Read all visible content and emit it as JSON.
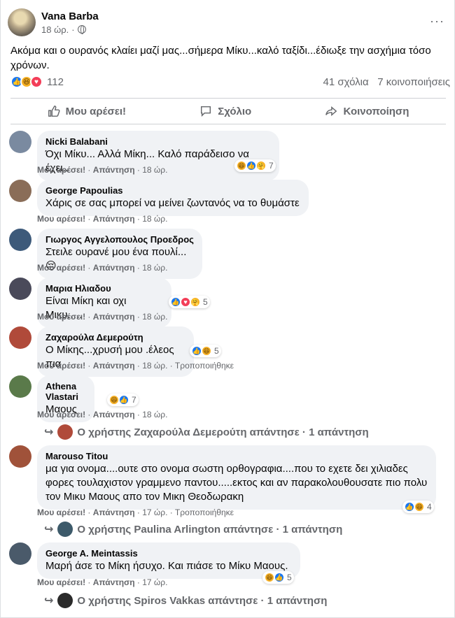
{
  "post": {
    "author": "Vana Barba",
    "time": "18 ώρ.",
    "text": "Ακόμα και ο ουρανός κλαίει μαζί μας...σήμερα Μίκυ...καλό ταξίδι...έδιωξε την ασχήμια τόσο χρόνων.",
    "reaction_count": "112",
    "comments_count": "41 σχόλια",
    "shares_count": "7 κοινοποιήσεις",
    "more": "···"
  },
  "actions": {
    "like": "Μου αρέσει!",
    "comment": "Σχόλιο",
    "share": "Κοινοποίηση"
  },
  "comments": [
    {
      "name": "Nicki Balabani",
      "text": "Όχι Μίκυ... Αλλά Μίκη... Καλό παράδεισο να έχει..",
      "like": "Μου αρέσει!",
      "reply": "Απάντηση",
      "time": "18 ώρ.",
      "edited": "",
      "reactions": "7",
      "avatar_color": "#7a8aa0"
    },
    {
      "name": "George Papoulias",
      "text": "Χάρις σε σας μπορεί να μείνει ζωντανός να το θυμάστε",
      "like": "Μου αρέσει!",
      "reply": "Απάντηση",
      "time": "18 ώρ.",
      "edited": "",
      "reactions": "",
      "avatar_color": "#8a6d58"
    },
    {
      "name": "Γιωργος Αγγελοπουλος Προεδρος",
      "text": "Στειλε ουρανέ μου ένα πουλί...",
      "like": "Μου αρέσει!",
      "reply": "Απάντηση",
      "time": "18 ώρ.",
      "edited": "",
      "reactions": "",
      "avatar_color": "#3d5a7a"
    },
    {
      "name": "Μαρια Ηλιαδου",
      "text": "Είναι Μίκη και οχι Μικυ.....",
      "like": "Μου αρέσει!",
      "reply": "Απάντηση",
      "time": "18 ώρ.",
      "edited": "",
      "reactions": "5",
      "avatar_color": "#4a4a5a"
    },
    {
      "name": "Ζαχαρούλα Δεμερούτη",
      "text": "Ο Μίκης...χρυσή μου .έλεος πια",
      "like": "Μου αρέσει!",
      "reply": "Απάντηση",
      "time": "18 ώρ.",
      "edited": "Τροποποιήθηκε",
      "reactions": "5",
      "avatar_color": "#b04a3a"
    },
    {
      "name": "Athena Vlastari",
      "text": "Μαους",
      "like": "Μου αρέσει!",
      "reply": "Απάντηση",
      "time": "18 ώρ.",
      "edited": "",
      "reactions": "7",
      "avatar_color": "#5a7a4a"
    },
    {
      "name": "Marouso Titou",
      "text": "μα για ονομα....ουτε στο ονομα σωστη ορθογραφια....που το εχετε δει χιλιαδες φορες τουλαχιστον γραμμενο παντου.....εκτος και αν παρακολουθουσατε πιο πολυ τον Μικυ Μαους απο τον Μικη Θεοδωρακη",
      "like": "Μου αρέσει!",
      "reply": "Απάντηση",
      "time": "17 ώρ.",
      "edited": "Τροποποιήθηκε",
      "reactions": "4",
      "avatar_color": "#a0523a"
    },
    {
      "name": "George A. Meintassis",
      "text": "Μαρή άσε το Μίκη ήσυχο. Και πιάσε το Μίκυ Μαους.",
      "like": "Μου αρέσει!",
      "reply": "Απάντηση",
      "time": "17 ώρ.",
      "edited": "",
      "reactions": "5",
      "avatar_color": "#4a5a6a"
    }
  ],
  "replies": {
    "athena": "Ο χρήστης Ζαχαρούλα Δεμερούτη απάντησε · 1 απάντηση",
    "marouso": "Ο χρήστης Paulina Arlington απάντησε · 1 απάντηση",
    "george": "Ο χρήστης Spiros Vakkas απάντησε · 1 απάντηση"
  },
  "colors": {
    "like": "#1877f2",
    "haha": "#f7b125",
    "love": "#f33e58",
    "secondary_text": "#65676b",
    "bubble": "#f0f2f5"
  }
}
